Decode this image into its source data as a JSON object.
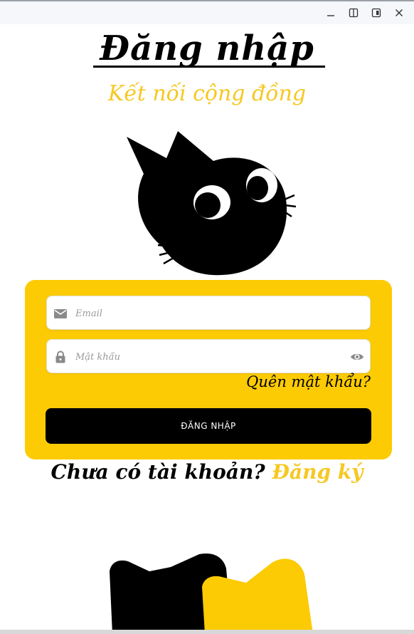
{
  "window": {
    "controls": [
      {
        "name": "minimize",
        "icon": "minimize-icon"
      },
      {
        "name": "split-view",
        "icon": "split-view-icon"
      },
      {
        "name": "snap-window",
        "icon": "snap-window-icon"
      },
      {
        "name": "close",
        "icon": "close-icon"
      }
    ]
  },
  "page": {
    "title": "Đăng nhập",
    "subtitle": "Kết nối cộng đồng"
  },
  "form": {
    "email": {
      "placeholder": "Email",
      "value": "",
      "icon": "mail-icon"
    },
    "password": {
      "placeholder": "Mật khẩu",
      "value": "",
      "icon": "lock-icon",
      "toggle_icon": "eye-icon"
    },
    "forgot_label": "Quên mật khẩu?",
    "submit_label": "ĐĂNG NHẬP"
  },
  "signup": {
    "prompt": "Chưa có tài khoản? ",
    "link": "Đăng ký"
  },
  "illustrations": [
    "cat-head-icon",
    "cats-bottom-icon"
  ],
  "colors": {
    "accent_yellow": "#fccb04",
    "text_yellow": "#f6c823",
    "button_black": "#000000",
    "background": "#ffffff"
  }
}
